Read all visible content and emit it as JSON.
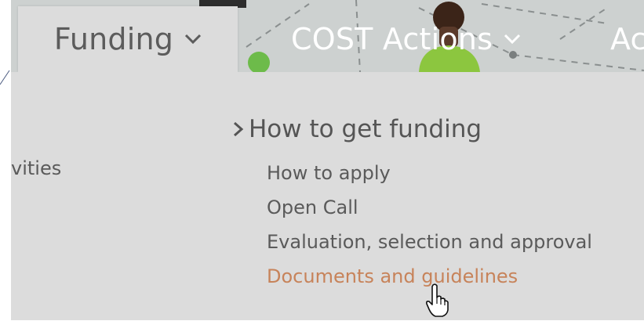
{
  "nav": {
    "funding": "Funding",
    "cost_actions": "COST Actions",
    "third_partial": "Ac"
  },
  "icons": {
    "dropdown": "chevron-down-icon",
    "group": "chevron-right-icon",
    "cursor": "hand-pointer-icon"
  },
  "dropdown": {
    "left_partial": "vities",
    "group_title": "How to get funding",
    "links": [
      {
        "label": "How to apply"
      },
      {
        "label": "Open Call"
      },
      {
        "label": "Evaluation, selection and approval"
      },
      {
        "label": "Documents and guidelines",
        "active": true
      }
    ]
  },
  "colors": {
    "panel_bg": "#dcdcdc",
    "text": "#5a5a5a",
    "active_link": "#c7835a",
    "header_text": "#ffffff"
  }
}
